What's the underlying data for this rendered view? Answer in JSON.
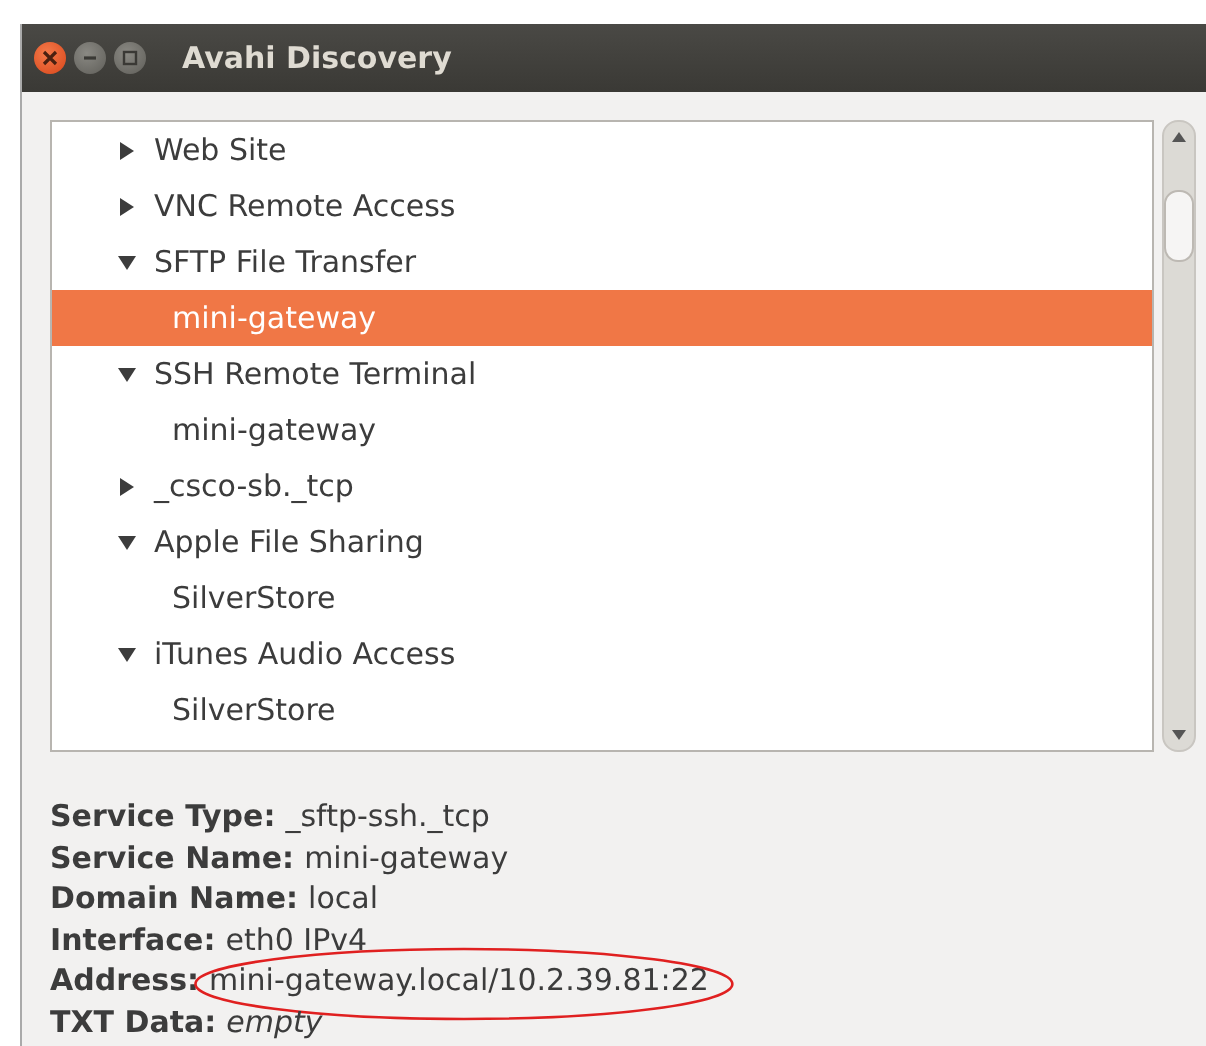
{
  "window": {
    "title": "Avahi Discovery"
  },
  "tree": [
    {
      "label": "Web Site",
      "expanded": false,
      "selected": false
    },
    {
      "label": "VNC Remote Access",
      "expanded": false,
      "selected": false
    },
    {
      "label": "SFTP File Transfer",
      "expanded": true,
      "selected": false,
      "children": [
        {
          "label": "mini-gateway",
          "selected": true
        }
      ]
    },
    {
      "label": "SSH Remote Terminal",
      "expanded": true,
      "selected": false,
      "children": [
        {
          "label": "mini-gateway",
          "selected": false
        }
      ]
    },
    {
      "label": "_csco-sb._tcp",
      "expanded": false,
      "selected": false
    },
    {
      "label": "Apple File Sharing",
      "expanded": true,
      "selected": false,
      "children": [
        {
          "label": "SilverStore",
          "selected": false
        }
      ]
    },
    {
      "label": "iTunes Audio Access",
      "expanded": true,
      "selected": false,
      "children": [
        {
          "label": "SilverStore",
          "selected": false
        }
      ]
    }
  ],
  "details": [
    {
      "label": "Service Type:",
      "value": "_sftp-ssh._tcp",
      "italic": false,
      "circled": false
    },
    {
      "label": "Service Name:",
      "value": "mini-gateway",
      "italic": false,
      "circled": false
    },
    {
      "label": "Domain Name:",
      "value": "local",
      "italic": false,
      "circled": false
    },
    {
      "label": "Interface:",
      "value": "eth0 IPv4",
      "italic": false,
      "circled": false
    },
    {
      "label": "Address:",
      "value": "mini-gateway.local/10.2.39.81:22",
      "italic": false,
      "circled": true
    },
    {
      "label": "TXT Data:",
      "value": "empty",
      "italic": true,
      "circled": false
    }
  ]
}
